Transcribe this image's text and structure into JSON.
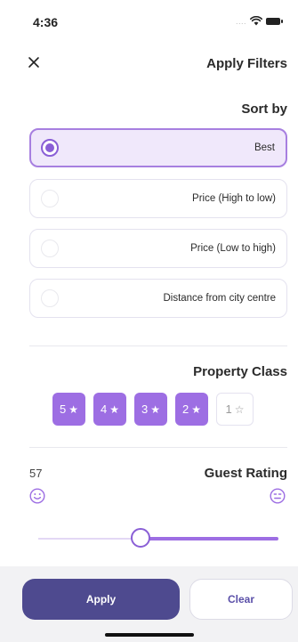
{
  "status_bar": {
    "time": "4:36",
    "signal": "....",
    "wifi_icon": "wifi-icon",
    "battery_icon": "battery-icon"
  },
  "header": {
    "close_icon": "close-icon",
    "title": "Apply Filters"
  },
  "sort": {
    "title": "Sort by",
    "options": [
      {
        "label": "Best",
        "selected": true
      },
      {
        "label": "Price (High to low)",
        "selected": false
      },
      {
        "label": "Price (Low to high)",
        "selected": false
      },
      {
        "label": "Distance from city centre",
        "selected": false
      }
    ]
  },
  "property_class": {
    "title": "Property Class",
    "chips": [
      {
        "value": "5",
        "selected": true
      },
      {
        "value": "4",
        "selected": true
      },
      {
        "value": "3",
        "selected": true
      },
      {
        "value": "2",
        "selected": true
      },
      {
        "value": "1",
        "selected": false
      }
    ]
  },
  "guest_rating": {
    "title": "Guest Rating",
    "value": "57",
    "min_icon": "smile-face-icon",
    "max_icon": "neutral-face-icon",
    "slider_fraction": 0.43
  },
  "footer": {
    "apply_label": "Apply",
    "clear_label": "Clear"
  },
  "colors": {
    "accent": "#9d6ee3",
    "accent_dark": "#8a5fd6",
    "primary_button": "#4e4a8f",
    "selected_bg": "#f0e8fb"
  }
}
